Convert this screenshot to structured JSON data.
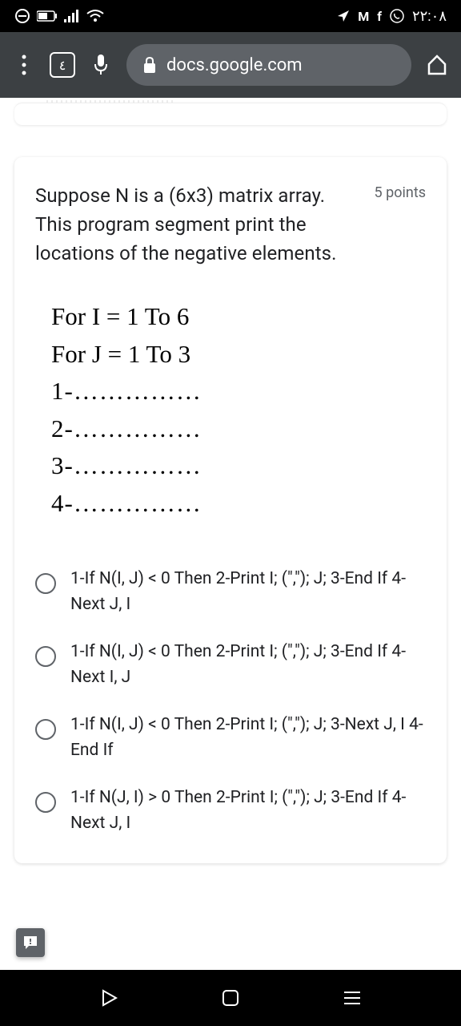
{
  "status_bar": {
    "time": "٢٢:٠٨"
  },
  "browser": {
    "tab_count": "٤",
    "url": "docs.google.com"
  },
  "question": {
    "text": "Suppose N is a (6x3) matrix array. This program segment print the locations of the negative elements.",
    "points": "5 points",
    "code": {
      "line1": "For I = 1 To 6",
      "line2": "For J = 1 To 3",
      "fill1": "1-……………",
      "fill2": "2-……………",
      "fill3": "3-……………",
      "fill4": "4-……………"
    },
    "options": [
      "1-If N(I, J) < 0 Then 2-Print I; (\",\"); J; 3-End If 4-Next J, I",
      "1-If N(I, J) < 0 Then 2-Print I; (\",\"); J; 3-End If 4-Next I, J",
      "1-If N(I, J) < 0 Then 2-Print I; (\",\"); J; 3-Next J, I 4-End If",
      "1-If N(J, I) > 0 Then 2-Print I; (\",\"); J; 3-End If 4-Next J, I"
    ]
  }
}
